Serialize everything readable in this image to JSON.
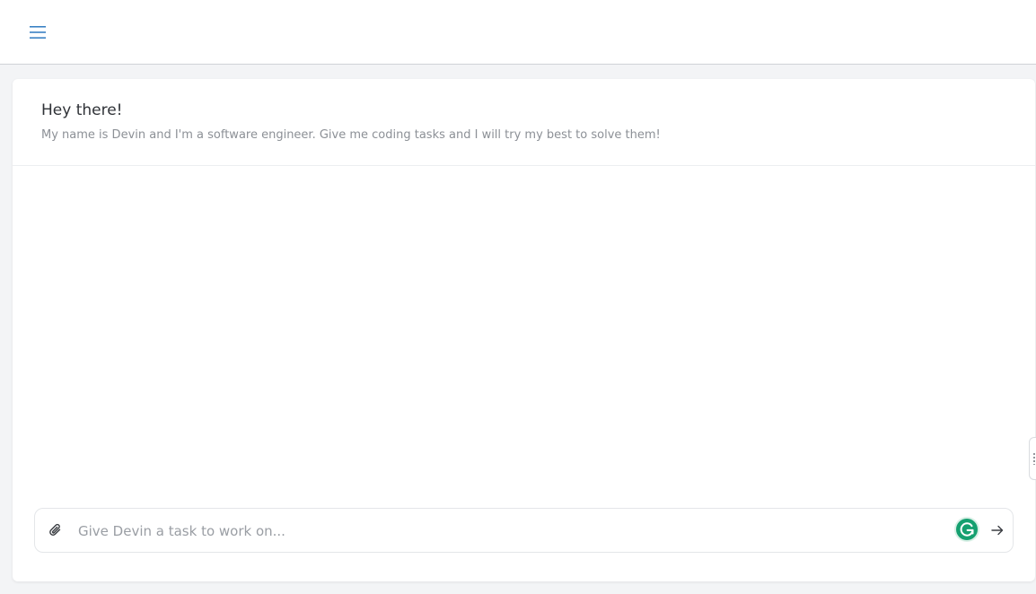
{
  "header": {
    "menu_icon": "hamburger-menu-icon"
  },
  "intro": {
    "title": "Hey there!",
    "subtitle": "My name is Devin and I'm a software engineer. Give me coding tasks and I will try my best to solve them!"
  },
  "composer": {
    "placeholder": "Give Devin a task to work on...",
    "value": "",
    "attach_icon": "paperclip-icon",
    "grammarly_icon": "grammarly-icon",
    "send_icon": "arrow-right-icon"
  },
  "colors": {
    "accent": "#3b82c4",
    "grammarly": "#15a070",
    "background": "#f3f4f6"
  }
}
